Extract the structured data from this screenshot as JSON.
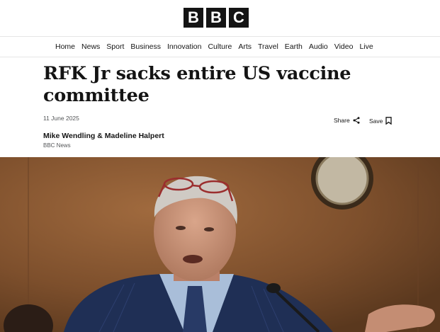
{
  "masthead": {
    "logo_letters": [
      "B",
      "B",
      "C"
    ]
  },
  "nav": {
    "items": [
      "Home",
      "News",
      "Sport",
      "Business",
      "Innovation",
      "Culture",
      "Arts",
      "Travel",
      "Earth",
      "Audio",
      "Video",
      "Live"
    ]
  },
  "article": {
    "headline": "RFK Jr sacks entire US vaccine committee",
    "date": "11 June 2025",
    "share_label": "Share",
    "save_label": "Save",
    "authors": "Mike Wendling & Madeline Halpert",
    "organisation": "BBC News"
  },
  "hero_image": {
    "description_icon": "photo",
    "colors": {
      "wall": "#7a4c2a",
      "suit": "#1f2f55",
      "clock_frame": "#3a2a1a"
    }
  }
}
